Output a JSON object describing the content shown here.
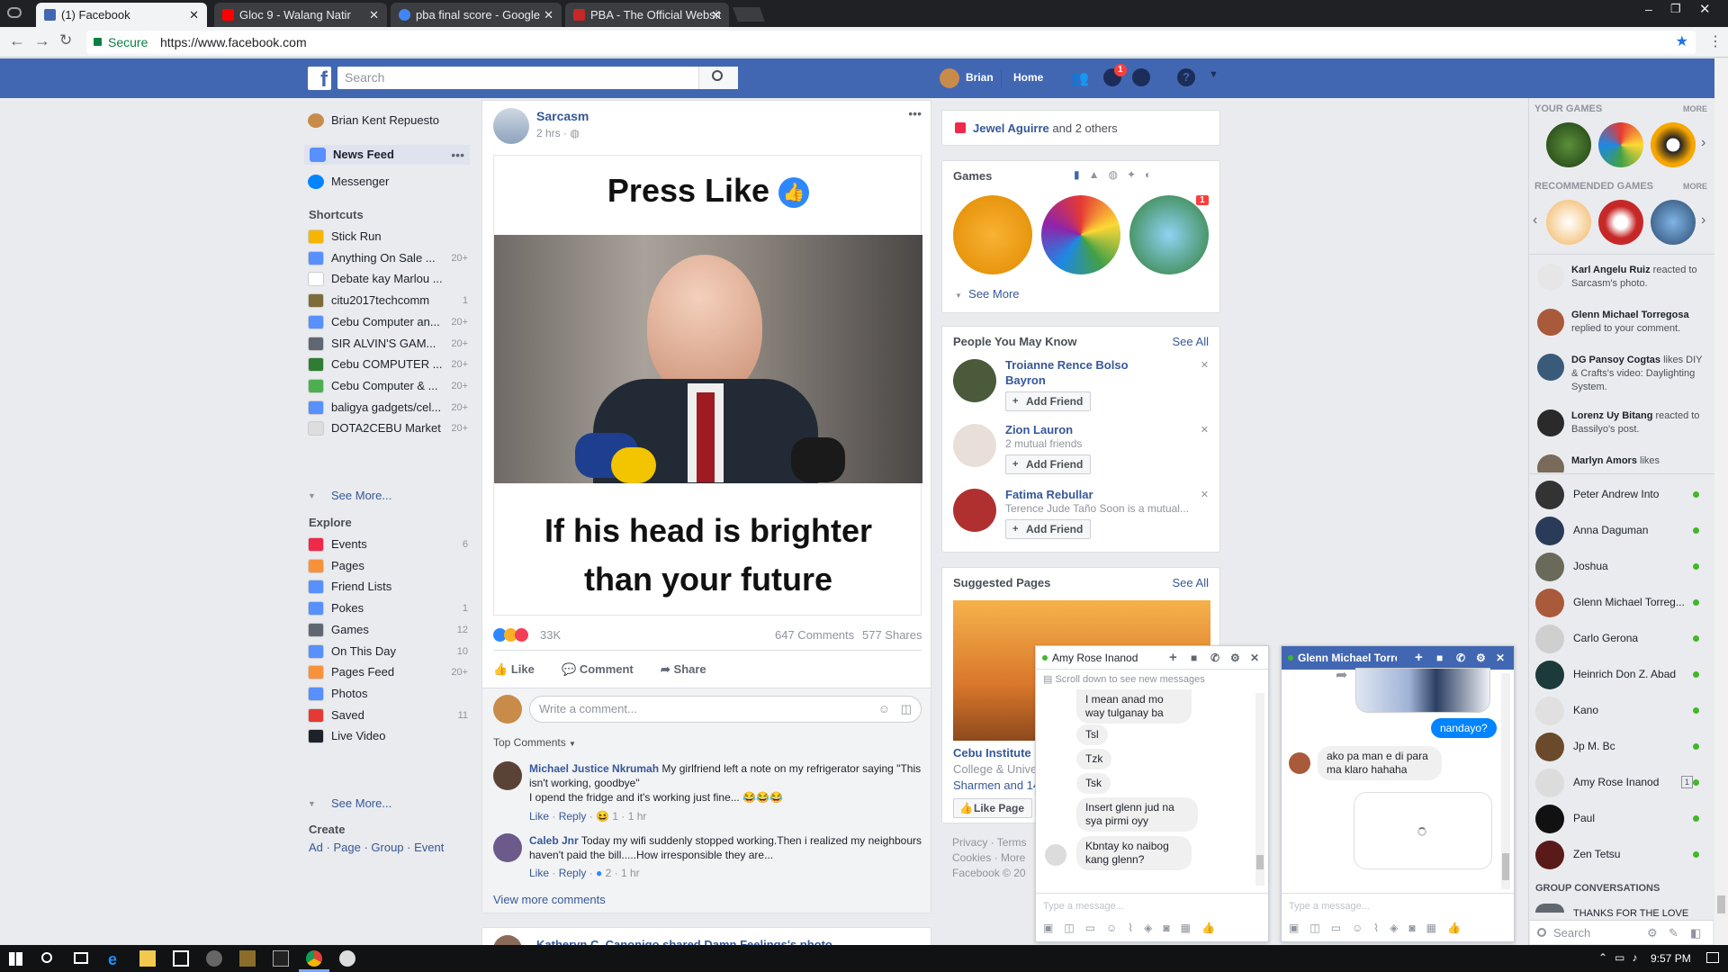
{
  "browser": {
    "tabs": [
      {
        "title": "(1) Facebook",
        "fav": "#4267b2"
      },
      {
        "title": "Gloc 9 - Walang Natir",
        "fav": "#ff0000"
      },
      {
        "title": "pba final score - Google",
        "fav": "#4285f4"
      },
      {
        "title": "PBA - The Official Websit",
        "fav": "#c62828"
      }
    ],
    "secure_label": "Secure",
    "url": "https://www.facebook.com"
  },
  "fbbar": {
    "search_placeholder": "Search",
    "user": "Brian",
    "home": "Home",
    "messages_badge": "1"
  },
  "leftnav": {
    "profile": "Brian Kent Repuesto",
    "newsfeed": "News Feed",
    "messenger": "Messenger",
    "shortcuts_title": "Shortcuts",
    "shortcuts": [
      {
        "label": "Stick Run",
        "count": "",
        "color": "#f7b500"
      },
      {
        "label": "Anything On Sale ...",
        "count": "20+",
        "color": "#5890ff"
      },
      {
        "label": "Debate kay Marlou ...",
        "count": "",
        "color": "#ffffff"
      },
      {
        "label": "citu2017techcomm",
        "count": "1",
        "color": "#7d6b3a"
      },
      {
        "label": "Cebu Computer an...",
        "count": "20+",
        "color": "#5890ff"
      },
      {
        "label": "SIR ALVIN'S GAM...",
        "count": "20+",
        "color": "#606770"
      },
      {
        "label": "Cebu COMPUTER ...",
        "count": "20+",
        "color": "#2e7d32"
      },
      {
        "label": "Cebu Computer & ...",
        "count": "20+",
        "color": "#4caf50"
      },
      {
        "label": "baligya gadgets/cel...",
        "count": "20+",
        "color": "#5890ff"
      },
      {
        "label": "DOTA2CEBU Market",
        "count": "20+",
        "color": "#dddddd"
      }
    ],
    "see_more": "See More...",
    "explore_title": "Explore",
    "explore": [
      {
        "label": "Events",
        "count": "6",
        "color": "#f02849"
      },
      {
        "label": "Pages",
        "count": "",
        "color": "#f7923b"
      },
      {
        "label": "Friend Lists",
        "count": "",
        "color": "#5890ff"
      },
      {
        "label": "Pokes",
        "count": "1",
        "color": "#5890ff"
      },
      {
        "label": "Games",
        "count": "12",
        "color": "#606770"
      },
      {
        "label": "On This Day",
        "count": "10",
        "color": "#5890ff"
      },
      {
        "label": "Pages Feed",
        "count": "20+",
        "color": "#f7923b"
      },
      {
        "label": "Photos",
        "count": "",
        "color": "#5890ff"
      },
      {
        "label": "Saved",
        "count": "11",
        "color": "#e53935"
      },
      {
        "label": "Live Video",
        "count": "",
        "color": "#1d2129"
      }
    ],
    "see_more2": "See More...",
    "create_title": "Create",
    "create_links": [
      "Ad",
      "Page",
      "Group",
      "Event"
    ]
  },
  "post": {
    "author": "Sarcasm",
    "time": "2 hrs",
    "meme_top": "Press Like",
    "meme_bottom_1": "If his head is brighter",
    "meme_bottom_2": "than your future",
    "reactions_count": "33K",
    "comments_count": "647 Comments",
    "shares_count": "577 Shares",
    "like": "Like",
    "comment": "Comment",
    "share": "Share",
    "write_placeholder": "Write a comment...",
    "top_comments": "Top Comments",
    "comments": [
      {
        "name": "Michael Justice Nkrumah",
        "text": "My girlfriend left a note on my refrigerator saying \"This isn't working, goodbye\"",
        "text2": "I opend the fridge and it's working just fine... 😂😂😂",
        "like": "Like",
        "reply": "Reply",
        "reacts": "1",
        "time": "1 hr"
      },
      {
        "name": "Caleb Jnr",
        "text": "Today my wifi suddenly stopped working.Then i realized my neighbours haven't paid the bill.....How irresponsible they are...",
        "text2": "",
        "like": "Like",
        "reply": "Reply",
        "reacts": "2",
        "time": "1 hr"
      }
    ],
    "view_more": "View more comments",
    "next_post": "Katheryn C. Canonigo shared Damn Feelings's photo."
  },
  "right": {
    "birthday_name": "Jewel Aguirre",
    "birthday_rest": " and 2 others",
    "games_title": "Games",
    "games_see_more": "See More",
    "games_badge": "1",
    "pymk_title": "People You May Know",
    "see_all": "See All",
    "pymk": [
      {
        "name": "Troianne Rence Bolso Bayron",
        "sub": "",
        "btn": "Add Friend"
      },
      {
        "name": "Zion Lauron",
        "sub": "2 mutual friends",
        "btn": "Add Friend"
      },
      {
        "name": "Fatima Rebullar",
        "sub": "Terence Jude Taño Soon is a mutual...",
        "btn": "Add Friend"
      }
    ],
    "suggested_title": "Suggested Pages",
    "suggested_see_all": "See All",
    "page_name": "Cebu Institute",
    "page_sub": "College & Unive",
    "page_friends": "Sharmen and 14",
    "like_page": "Like Page",
    "footer": [
      "Privacy · Terms",
      "Cookies · More",
      "Facebook © 20"
    ]
  },
  "sidebar": {
    "your_games": "YOUR GAMES",
    "more": "MORE",
    "recommended_games": "RECOMMENDED GAMES",
    "ticker": [
      {
        "bold": "Karl Angelu Ruiz",
        "text": " reacted to Sarcasm's photo."
      },
      {
        "bold": "Glenn Michael Torregosa",
        "text": " replied to your comment."
      },
      {
        "bold": "DG Pansoy Cogtas",
        "text": " likes DIY & Crafts's video: Daylighting System."
      },
      {
        "bold": "Lorenz Uy Bitang",
        "text": " reacted to Bassilyo's post."
      },
      {
        "bold": "Marlyn Amors",
        "text": " likes"
      }
    ],
    "contacts": [
      {
        "name": "Peter Andrew Into",
        "badge": ""
      },
      {
        "name": "Anna Daguman",
        "badge": ""
      },
      {
        "name": "Joshua",
        "badge": ""
      },
      {
        "name": "Glenn Michael Torreg...",
        "badge": ""
      },
      {
        "name": "Carlo Gerona",
        "badge": ""
      },
      {
        "name": "Heinrich Don Z. Abad",
        "badge": ""
      },
      {
        "name": "Kano",
        "badge": ""
      },
      {
        "name": "Jp M. Bc",
        "badge": ""
      },
      {
        "name": "Amy Rose Inanod",
        "badge": "1"
      },
      {
        "name": "Paul",
        "badge": ""
      },
      {
        "name": "Zen Tetsu",
        "badge": ""
      }
    ],
    "group_conversations": "GROUP CONVERSATIONS",
    "group_item": "THANKS FOR THE LOVE",
    "search_placeholder": "Search"
  },
  "chat1": {
    "name": "Amy Rose Inanod",
    "scroll_hint": "Scroll down to see new messages",
    "messages": [
      "I mean anad mo way tulganay ba",
      "Tsl",
      "Tzk",
      "Tsk",
      "Insert glenn jud na sya pirmi oyy",
      "Kbntay ko naibog kang glenn?"
    ],
    "input_placeholder": "Type a message..."
  },
  "chat2": {
    "name": "Glenn Michael Torrego",
    "sent": "nandayo?",
    "received": "ako pa man e di para ma klaro hahaha",
    "input_placeholder": "Type a message..."
  },
  "taskbar": {
    "time": "9:57 PM"
  }
}
